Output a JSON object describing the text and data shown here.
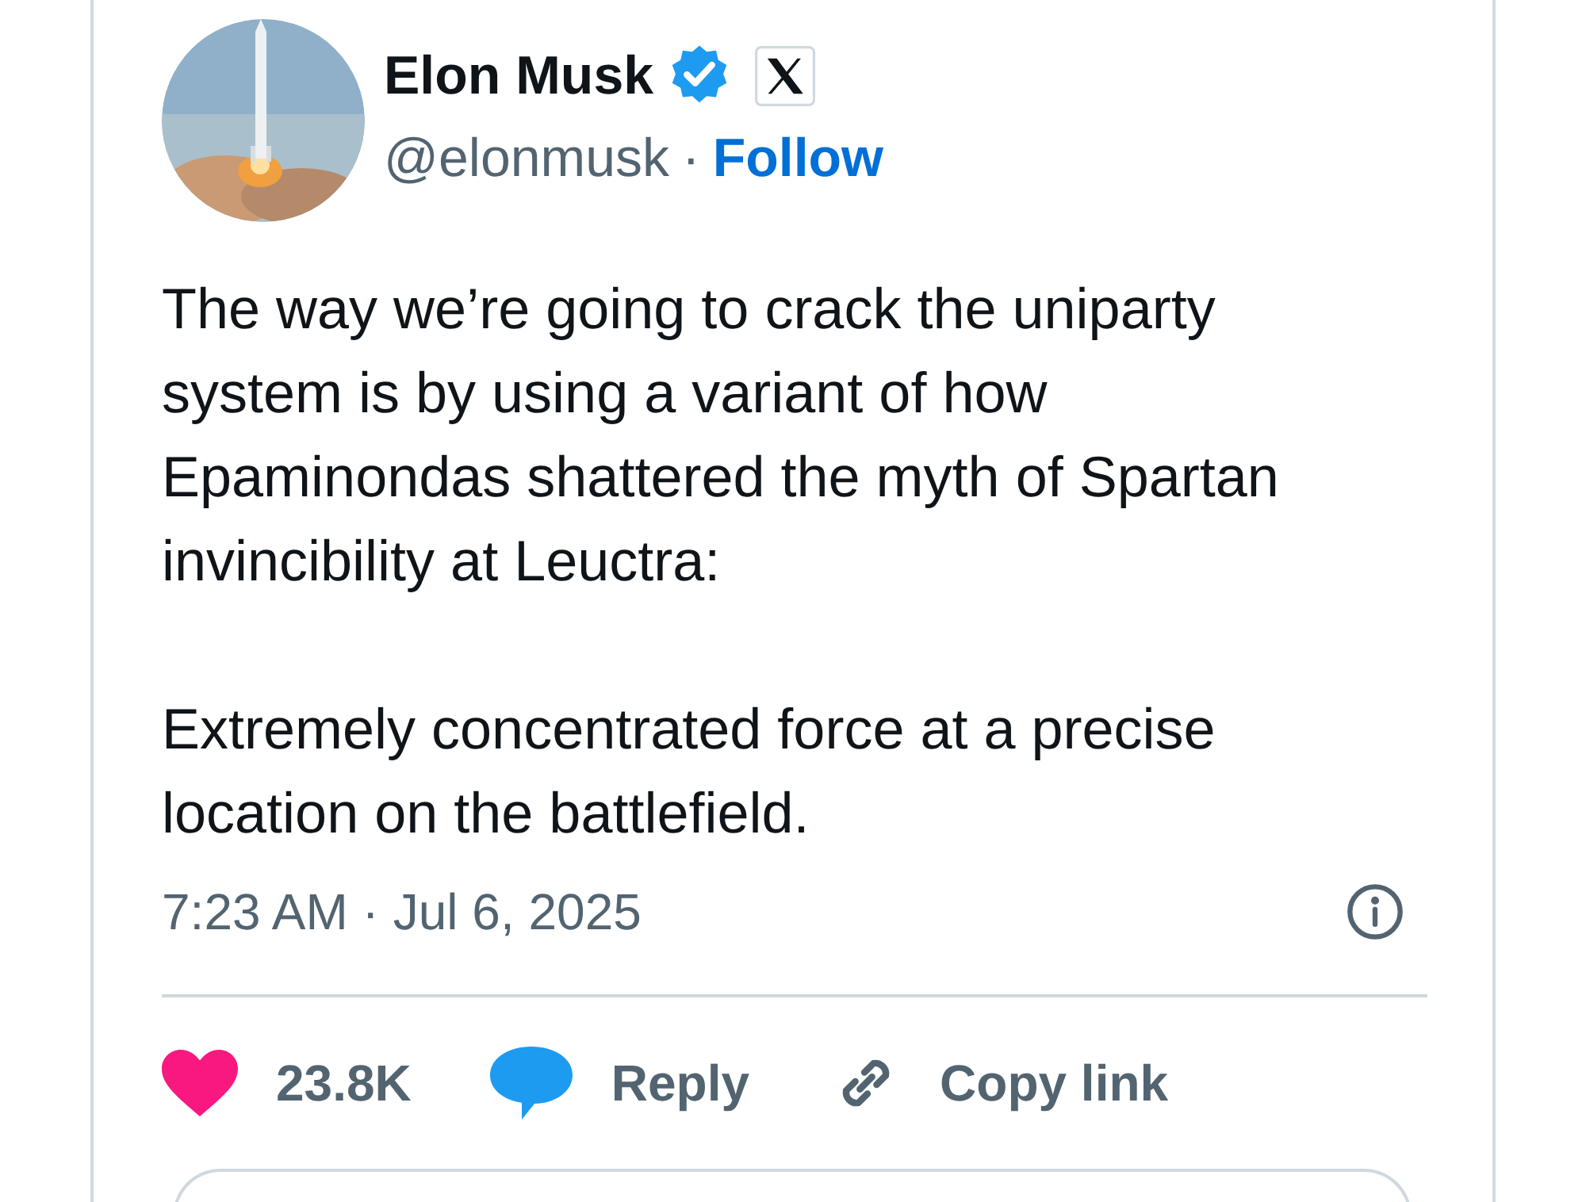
{
  "author": {
    "name": "Elon Musk",
    "verified": true,
    "handle": "@elonmusk",
    "separator": "·",
    "follow": "Follow"
  },
  "body": [
    "The way we’re going to crack the uniparty system is by using a variant of how Epaminondas shattered the myth of Spartan invincibility at Leuctra:",
    "Extremely concentrated force at a precise location on the battlefield."
  ],
  "timestamp": "7:23 AM · Jul 6, 2025",
  "actions": [
    {
      "kind": "like",
      "label": "23.8K"
    },
    {
      "kind": "reply",
      "label": "Reply"
    },
    {
      "kind": "link",
      "label": "Copy link"
    }
  ]
}
